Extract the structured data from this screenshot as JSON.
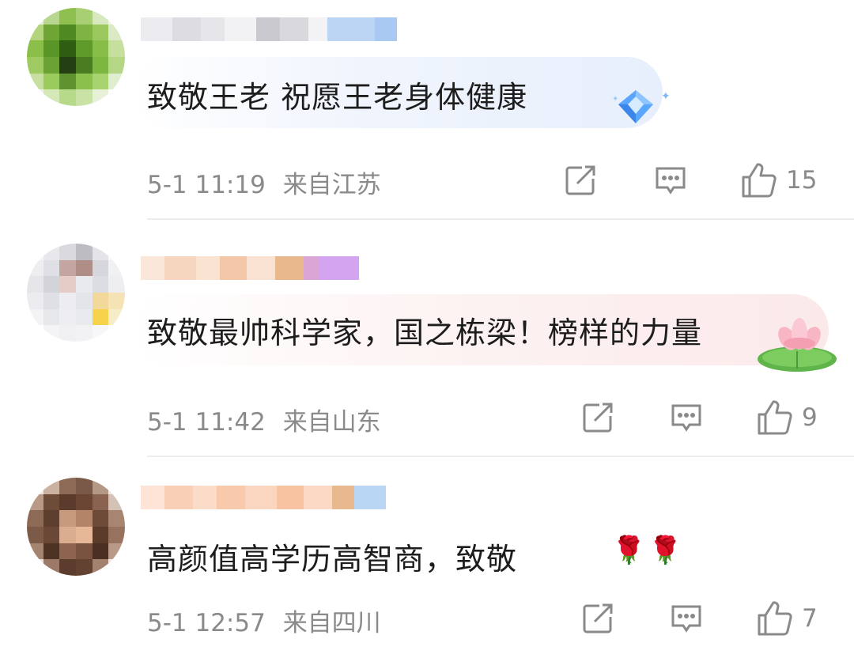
{
  "comments": [
    {
      "text": "致敬王老 祝愿王老身体健康",
      "time": "5-1 11:19",
      "location": "来自江苏",
      "likes": "15",
      "sticker": "diamond-sticker"
    },
    {
      "text": "致敬最帅科学家，国之栋梁！榜样的力量",
      "time": "5-1 11:42",
      "location": "来自山东",
      "likes": "9",
      "sticker": "lotus-sticker"
    },
    {
      "text": "高颜值高学历高智商，致敬",
      "time": "5-1 12:57",
      "location": "来自四川",
      "likes": "7",
      "emoji": "🌹🌹"
    }
  ],
  "icons": {
    "share": "share-icon",
    "reply": "comment-icon",
    "like": "thumbs-up-icon"
  },
  "colors": {
    "text": "#1d1d1d",
    "meta": "#8a8a8a",
    "divider": "#ececec"
  }
}
